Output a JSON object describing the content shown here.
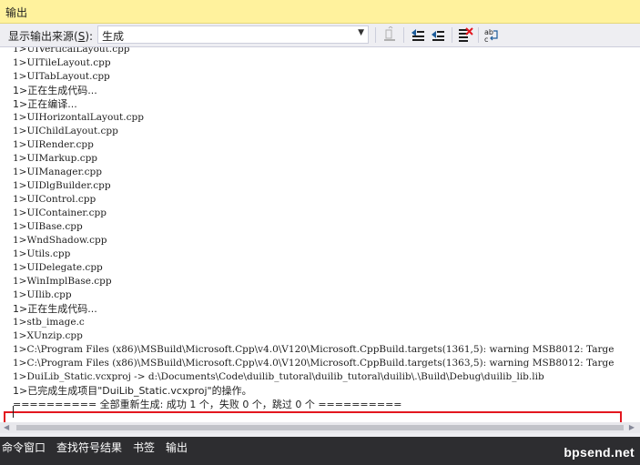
{
  "title": "输出",
  "toolbar": {
    "source_label": "显示输出来源(",
    "source_label_hotkey": "S",
    "source_label_end": "):",
    "source_value": "生成",
    "buttons": [
      "find-message-icon",
      "go-to-previous-message-icon",
      "go-to-next-message-icon",
      "clear-all-icon",
      "toggle-word-wrap-icon"
    ]
  },
  "output": {
    "lines": [
      "1>UIVerticalLayout.cpp",
      "1>UITileLayout.cpp",
      "1>UITabLayout.cpp",
      "1>正在生成代码...",
      "1>正在编译...",
      "1>UIHorizontalLayout.cpp",
      "1>UIChildLayout.cpp",
      "1>UIRender.cpp",
      "1>UIMarkup.cpp",
      "1>UIManager.cpp",
      "1>UIDlgBuilder.cpp",
      "1>UIControl.cpp",
      "1>UIContainer.cpp",
      "1>UIBase.cpp",
      "1>WndShadow.cpp",
      "1>Utils.cpp",
      "1>UIDelegate.cpp",
      "1>WinImplBase.cpp",
      "1>UIlib.cpp",
      "1>正在生成代码...",
      "1>stb_image.c",
      "1>XUnzip.cpp",
      "1>C:\\Program Files (x86)\\MSBuild\\Microsoft.Cpp\\v4.0\\V120\\Microsoft.CppBuild.targets(1361,5): warning MSB8012: Targe",
      "1>C:\\Program Files (x86)\\MSBuild\\Microsoft.Cpp\\v4.0\\V120\\Microsoft.CppBuild.targets(1363,5): warning MSB8012: Targe"
    ],
    "highlighted_line": "1>DuiLib_Static.vcxproj -> d:\\Documents\\Code\\duilib_tutoral\\duilib_tutoral\\duilib\\.\\Build\\Debug\\duilib_lib.lib",
    "completed_line": "1>已完成生成项目\"DuiLib_Static.vcxproj\"的操作。",
    "summary_line": "========== 全部重新生成: 成功 1 个，失败 0 个，跳过 0 个 =========="
  },
  "tabs": [
    "命令窗口",
    "查找符号结果",
    "书签",
    "输出"
  ],
  "watermark": "bpsend.net",
  "colors": {
    "title_bar": "#FFF29D",
    "tab_bar": "#2D2D30",
    "highlight_border": "#E3171F"
  }
}
